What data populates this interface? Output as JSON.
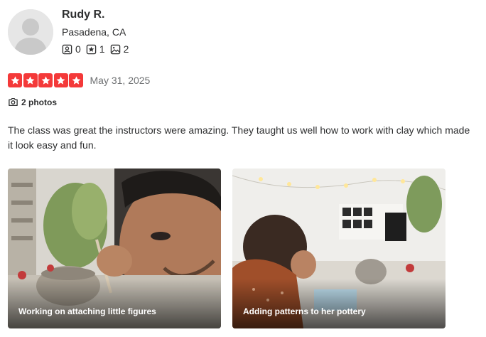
{
  "reviewer": {
    "name": "Rudy R.",
    "location": "Pasadena, CA",
    "stats": [
      {
        "icon": "friends-icon",
        "value": "0"
      },
      {
        "icon": "reviews-icon",
        "value": "1"
      },
      {
        "icon": "photos-icon",
        "value": "2"
      }
    ]
  },
  "review": {
    "rating": 5,
    "max_rating": 5,
    "date": "May 31, 2025",
    "photos_label": "2 photos",
    "text": "The class was great the instructors were amazing. They taught us well how to work with clay which made it look easy and fun.",
    "star_color": "#f43939",
    "photos": [
      {
        "caption": "Working on attaching little figures"
      },
      {
        "caption": "Adding patterns to her pottery"
      }
    ]
  }
}
